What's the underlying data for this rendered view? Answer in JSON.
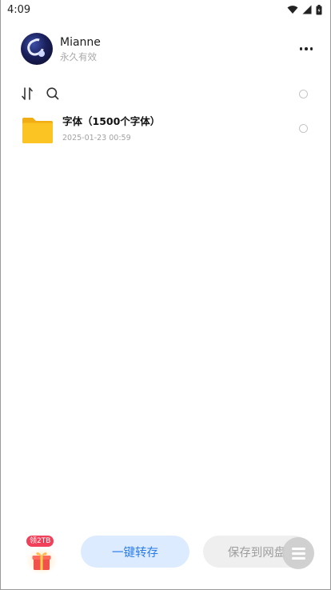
{
  "status_bar": {
    "time": "4:09",
    "icons": [
      "wifi-icon",
      "signal-icon",
      "battery-icon"
    ]
  },
  "header": {
    "user_name": "Mianne",
    "user_status": "永久有效",
    "more_icon": "more-horizontal-icon"
  },
  "toolbar": {
    "icons": [
      "sort-icon",
      "search-icon"
    ]
  },
  "files": [
    {
      "name": "字体（1500个字体）",
      "date": "2025-01-23 00:59",
      "icon": "folder-icon"
    }
  ],
  "bottom_bar": {
    "gift_badge": "领2TB",
    "transfer_label": "一键转存",
    "save_label": "保存到网盘"
  },
  "colors": {
    "accent": "#2b7de9",
    "transfer_bg": "#dcebff",
    "badge": "#f0405a",
    "folder": "#fcc422"
  }
}
